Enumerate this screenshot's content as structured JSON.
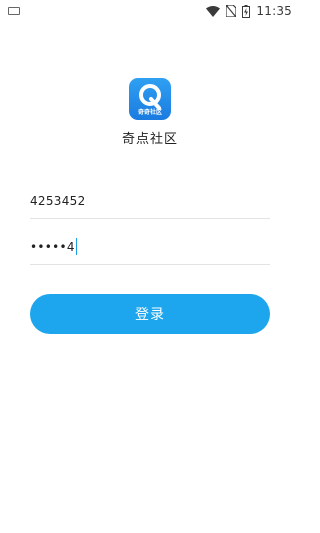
{
  "status_bar": {
    "time": "11:35",
    "icons": [
      "keyboard-icon",
      "wifi-icon",
      "no-sim-icon",
      "battery-icon"
    ]
  },
  "app": {
    "logo_text": "奇奇社区",
    "name": "奇点社区",
    "brand_color": "#1da6ee"
  },
  "form": {
    "account_value": "4253452",
    "password_value": "•••••4"
  },
  "login_button": {
    "label": "登录"
  }
}
